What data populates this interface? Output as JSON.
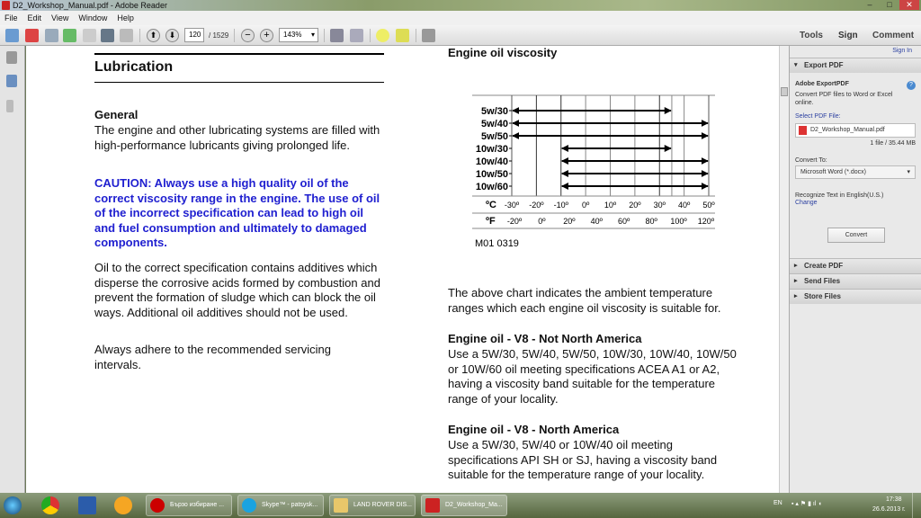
{
  "window": {
    "title": "D2_Workshop_Manual.pdf - Adobe Reader",
    "min": "–",
    "max": "□",
    "close": "✕"
  },
  "menu": [
    "File",
    "Edit",
    "View",
    "Window",
    "Help"
  ],
  "toolbar": {
    "page_current": "120",
    "page_total": "/ 1529",
    "zoom": "143%",
    "tools": "Tools",
    "sign": "Sign",
    "comment": "Comment"
  },
  "left": {
    "heading": "Lubrication",
    "general": "General",
    "p1": "The engine and other lubricating systems are filled with high-performance lubricants giving prolonged life.",
    "caution": "CAUTION: Always use a high quality oil of the correct viscosity range in the engine. The use of oil of the incorrect specification can lead to high oil and fuel consumption and ultimately to damaged components.",
    "p2": "Oil to the correct specification contains additives which disperse the corrosive acids formed by combustion and prevent the formation of sludge which can block the oil ways. Additional oil additives should not be used.",
    "p3": "Always adhere to the recommended servicing intervals."
  },
  "right": {
    "heading": "Engine oil viscosity",
    "chart_caption": "The above chart indicates the ambient temperature ranges which each engine oil viscosity is suitable for.",
    "h2": "Engine oil - V8 - Not North America",
    "p2": "Use a 5W/30, 5W/40, 5W/50, 10W/30, 10W/40, 10W/50 or 10W/60 oil meeting specifications ACEA A1 or A2, having a viscosity band suitable for the temperature range of your locality.",
    "h3": "Engine oil - V8  - North America",
    "p3": "Use a 5W/30, 5W/40 or 10W/40 oil meeting specifications API SH or SJ, having a viscosity band suitable for the temperature range of your locality."
  },
  "chart_data": {
    "type": "range",
    "title": "Engine oil viscosity",
    "code": "M01 0319",
    "xlabel_c": "ºC",
    "xlabel_f": "ºF",
    "xlim_c": [
      -30,
      50
    ],
    "c_ticks": [
      -30,
      -20,
      -10,
      0,
      10,
      20,
      30,
      40,
      50
    ],
    "c_tick_labels": [
      "-30º",
      "-20º",
      "-10º",
      "0º",
      "10º",
      "20º",
      "30º",
      "40º",
      "50º"
    ],
    "f_ticks": [
      -20,
      0,
      20,
      40,
      60,
      80,
      100,
      120
    ],
    "f_tick_labels": [
      "-20º",
      "0º",
      "20º",
      "40º",
      "60º",
      "80º",
      "100º",
      "120º"
    ],
    "gridlines_c": [
      -20,
      -10,
      0,
      10,
      20,
      30,
      35,
      40
    ],
    "series": [
      {
        "name": "5w/30",
        "min": -30,
        "max": 35
      },
      {
        "name": "5w/40",
        "min": -30,
        "max": 50
      },
      {
        "name": "5w/50",
        "min": -30,
        "max": 50
      },
      {
        "name": "10w/30",
        "min": -10,
        "max": 35
      },
      {
        "name": "10w/40",
        "min": -10,
        "max": 50
      },
      {
        "name": "10w/50",
        "min": -10,
        "max": 50
      },
      {
        "name": "10w/60",
        "min": -10,
        "max": 50
      }
    ]
  },
  "panel": {
    "sign_in": "Sign In",
    "export": "Export PDF",
    "product": "Adobe ExportPDF",
    "desc": "Convert PDF files to Word or Excel online.",
    "select": "Select PDF File:",
    "file": "D2_Workshop_Manual.pdf",
    "filesize": "1 file / 35.44 MB",
    "convert_to": "Convert To:",
    "format": "Microsoft Word (*.docx)",
    "recognize": "Recognize Text in English(U.S.)",
    "change": "Change",
    "convert": "Convert",
    "create": "Create PDF",
    "send": "Send Files",
    "store": "Store Files"
  },
  "taskbar": {
    "items": [
      "Бързо избиране ...",
      "Skype™ - patsysk...",
      "LAND ROVER DIS...",
      "D2_Workshop_Ma..."
    ],
    "lang": "EN",
    "time": "17:38",
    "date": "26.6.2013 г."
  }
}
